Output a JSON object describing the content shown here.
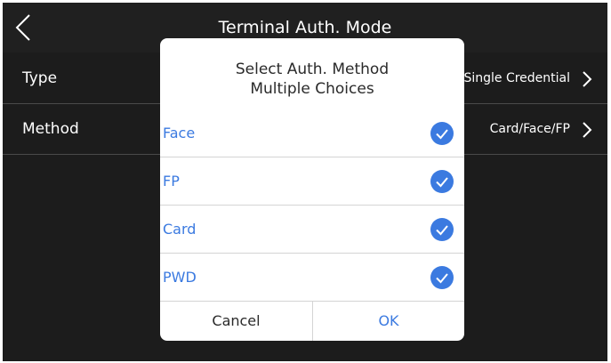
{
  "header": {
    "title": "Terminal Auth. Mode"
  },
  "settings": [
    {
      "label": "Type",
      "value": "Single Credential"
    },
    {
      "label": "Method",
      "value": "Card/Face/FP"
    }
  ],
  "dialog": {
    "title_line1": "Select Auth. Method",
    "title_line2": "Multiple Choices",
    "options": [
      {
        "label": "Face",
        "checked": true
      },
      {
        "label": "FP",
        "checked": true
      },
      {
        "label": "Card",
        "checked": true
      },
      {
        "label": "PWD",
        "checked": true
      }
    ],
    "cancel_label": "Cancel",
    "ok_label": "OK"
  },
  "colors": {
    "background": "#1c1c1c",
    "accent": "#3b7ae0",
    "dialog": "#ffffff"
  },
  "icons": [
    "back-arrow-icon",
    "chevron-right-icon",
    "checkmark-circle-icon"
  ]
}
